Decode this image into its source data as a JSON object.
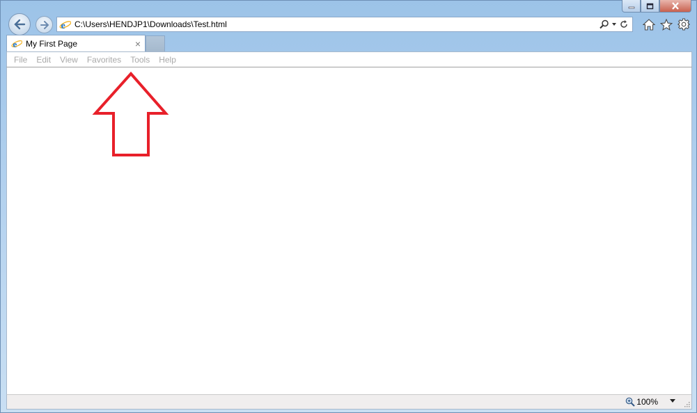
{
  "window": {
    "buttons": {
      "minimize": "minimize-icon",
      "maximize": "maximize-icon",
      "close": "close-icon"
    }
  },
  "nav": {
    "back_icon": "back-arrow-icon",
    "forward_icon": "forward-arrow-icon"
  },
  "address": {
    "url": "C:\\Users\\HENDJP1\\Downloads\\Test.html",
    "icons": [
      "search-icon",
      "dropdown-icon",
      "refresh-icon"
    ]
  },
  "toolbar_icons": [
    "home-icon",
    "favorites-star-icon",
    "gear-icon"
  ],
  "tabs": [
    {
      "title": "My First Page",
      "close": "×",
      "active": true
    }
  ],
  "menu": {
    "items": [
      "File",
      "Edit",
      "View",
      "Favorites",
      "Tools",
      "Help"
    ]
  },
  "status": {
    "zoom": "100%"
  },
  "annotation": {
    "shape": "up-arrow",
    "color": "#e8202a"
  },
  "colors": {
    "chrome": "#b9d5f0",
    "menu_text_disabled": "#a9a9a9",
    "annotation": "#e8202a"
  }
}
